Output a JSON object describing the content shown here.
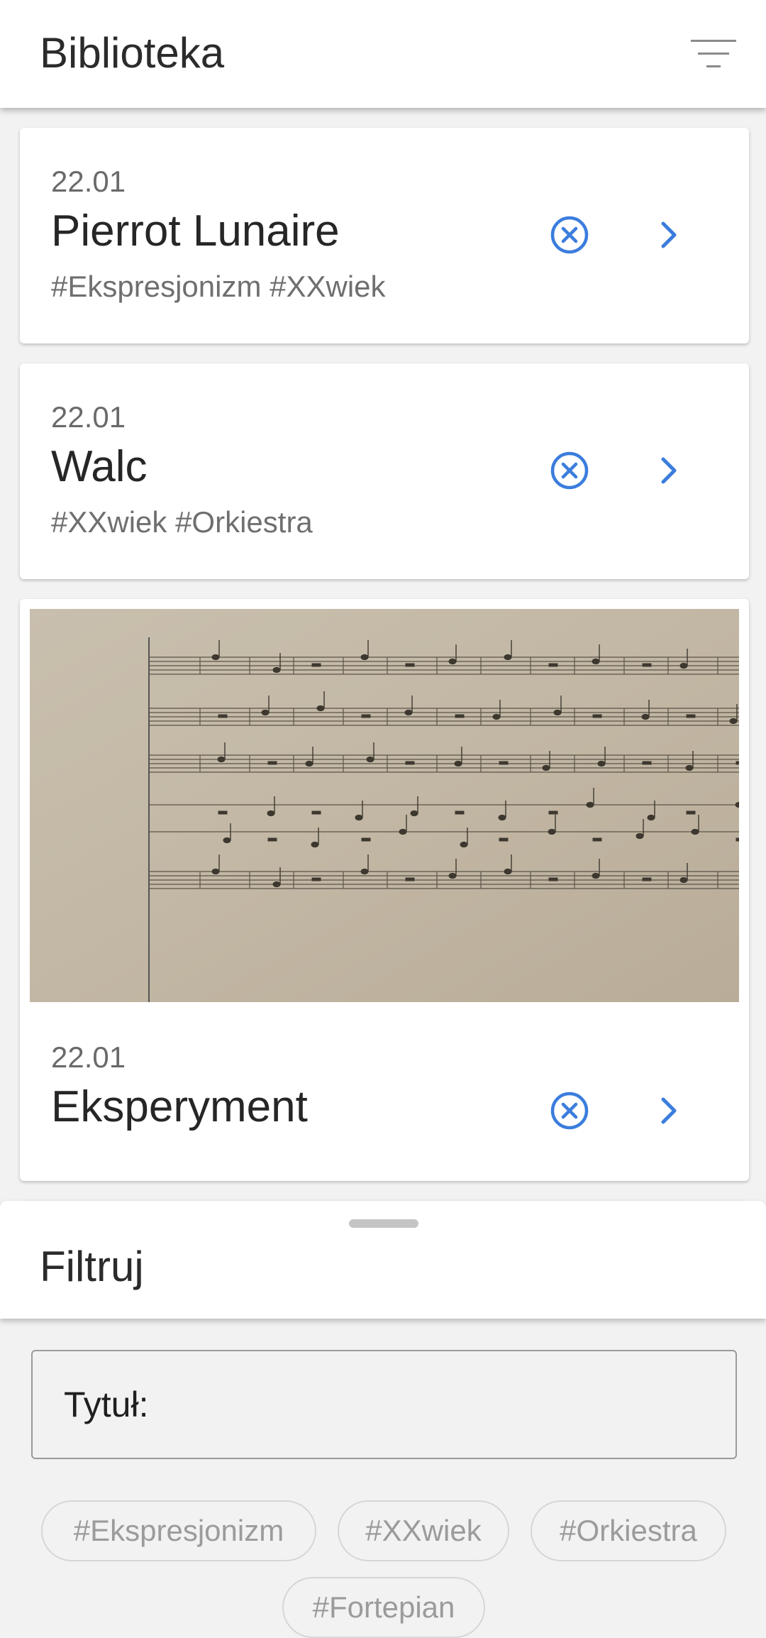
{
  "app_bar": {
    "title": "Biblioteka",
    "filter_icon": "filter-list-icon"
  },
  "colors": {
    "accent": "#3b7ddd",
    "card_bg": "#ffffff",
    "page_bg": "#f2f2f2"
  },
  "library": {
    "items": [
      {
        "date": "22.01",
        "title": "Pierrot Lunaire",
        "tags": "#Ekspresjonizm #XXwiek",
        "remove_icon": "remove-circle-icon",
        "open_icon": "chevron-right-icon"
      },
      {
        "date": "22.01",
        "title": "Walc",
        "tags": "#XXwiek #Orkiestra",
        "remove_icon": "remove-circle-icon",
        "open_icon": "chevron-right-icon"
      },
      {
        "date": "22.01",
        "title": "Eksperyment",
        "tags": "",
        "has_image": true,
        "image_subject": "sheet-music-score",
        "remove_icon": "remove-circle-icon",
        "open_icon": "chevron-right-icon"
      }
    ]
  },
  "filter_sheet": {
    "title": "Filtruj",
    "title_field_label": "Tytuł:",
    "title_field_value": "",
    "title_field_placeholder": "",
    "tags": [
      "#Ekspresjonizm",
      "#XXwiek",
      "#Orkiestra",
      "#Fortepian"
    ]
  }
}
